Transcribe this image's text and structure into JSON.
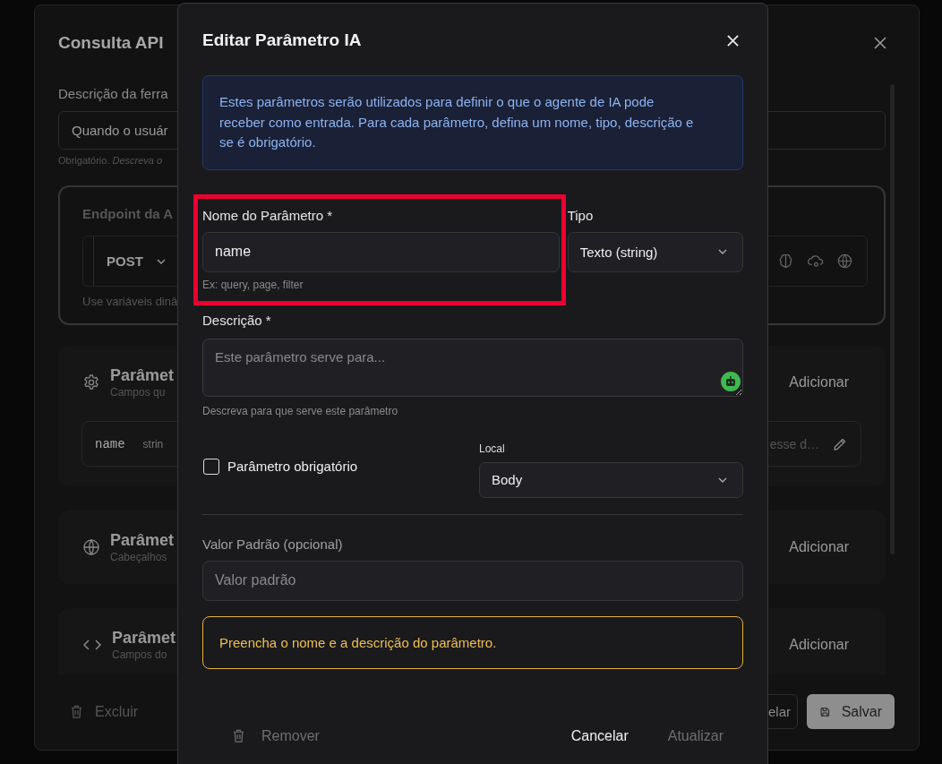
{
  "background_dialog": {
    "title": "Consulta API",
    "description_label": "Descrição da ferra",
    "description_value": "Quando o usuár",
    "description_hint": "Obrigatório. *Descreva o*",
    "endpoint": {
      "title": "Endpoint da A",
      "method": "POST",
      "hint": "Use variáveis dinâ"
    },
    "sections": [
      {
        "kind": "settings",
        "title": "Parâmet",
        "subtitle": "Campos qu",
        "add_label": "Adicionar",
        "rows": [
          {
            "name": "name",
            "type": "strin",
            "description": "esse d…"
          }
        ]
      },
      {
        "kind": "headers",
        "title": "Parâmet",
        "subtitle": "Cabeçalhos",
        "add_label": "Adicionar"
      },
      {
        "kind": "body",
        "title": "Parâmet",
        "subtitle": "Campos do",
        "add_label": "Adicionar"
      }
    ],
    "footer": {
      "delete_label": "Excluir",
      "cancel_label": "elar",
      "save_label": "Salvar"
    }
  },
  "dialog": {
    "title": "Editar Parâmetro IA",
    "info": "Estes parâmetros serão utilizados para definir o que o agente de IA pode receber como entrada. Para cada parâmetro, defina um nome, tipo, descrição e se é obrigatório.",
    "name_field": {
      "label": "Nome do Parâmetro *",
      "value": "name",
      "hint": "Ex: query, page, filter",
      "highlighted": true
    },
    "type_field": {
      "label": "Tipo",
      "value": "Texto (string)"
    },
    "description_field": {
      "label": "Descrição *",
      "placeholder": "Este parâmetro serve para...",
      "hint": "Descreva para que serve este parâmetro"
    },
    "required": {
      "label": "Parâmetro obrigatório",
      "checked": false
    },
    "location_field": {
      "label": "Local",
      "value": "Body"
    },
    "default_field": {
      "label": "Valor Padrão (opcional)",
      "placeholder": "Valor padrão"
    },
    "warning": "Preencha o nome e a descrição do parâmetro.",
    "remove_button": {
      "label": "Remover",
      "disabled": true
    },
    "cancel_button": {
      "label": "Cancelar",
      "disabled": false
    },
    "update_button": {
      "label": "Atualizar",
      "disabled": true
    }
  }
}
